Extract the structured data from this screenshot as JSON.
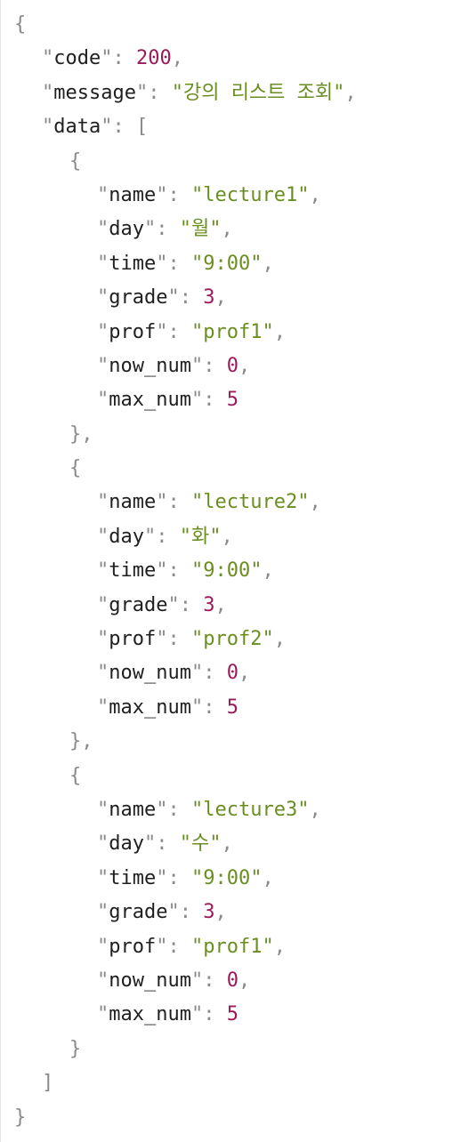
{
  "json_viewer": {
    "punctuation": {
      "open_brace": "{",
      "close_brace": "}",
      "open_bracket": "[",
      "close_bracket": "]",
      "colon": ": ",
      "comma": ",",
      "quote": "\""
    },
    "root": {
      "code_key": "code",
      "code_value": "200",
      "message_key": "message",
      "message_value": "강의 리스트 조회",
      "data_key": "data"
    },
    "items": [
      {
        "name_key": "name",
        "name_value": "lecture1",
        "day_key": "day",
        "day_value": "월",
        "time_key": "time",
        "time_value": "9:00",
        "grade_key": "grade",
        "grade_value": "3",
        "prof_key": "prof",
        "prof_value": "prof1",
        "now_num_key": "now_num",
        "now_num_value": "0",
        "max_num_key": "max_num",
        "max_num_value": "5"
      },
      {
        "name_key": "name",
        "name_value": "lecture2",
        "day_key": "day",
        "day_value": "화",
        "time_key": "time",
        "time_value": "9:00",
        "grade_key": "grade",
        "grade_value": "3",
        "prof_key": "prof",
        "prof_value": "prof2",
        "now_num_key": "now_num",
        "now_num_value": "0",
        "max_num_key": "max_num",
        "max_num_value": "5"
      },
      {
        "name_key": "name",
        "name_value": "lecture3",
        "day_key": "day",
        "day_value": "수",
        "time_key": "time",
        "time_value": "9:00",
        "grade_key": "grade",
        "grade_value": "3",
        "prof_key": "prof",
        "prof_value": "prof1",
        "now_num_key": "now_num",
        "now_num_value": "0",
        "max_num_key": "max_num",
        "max_num_value": "5"
      }
    ]
  }
}
